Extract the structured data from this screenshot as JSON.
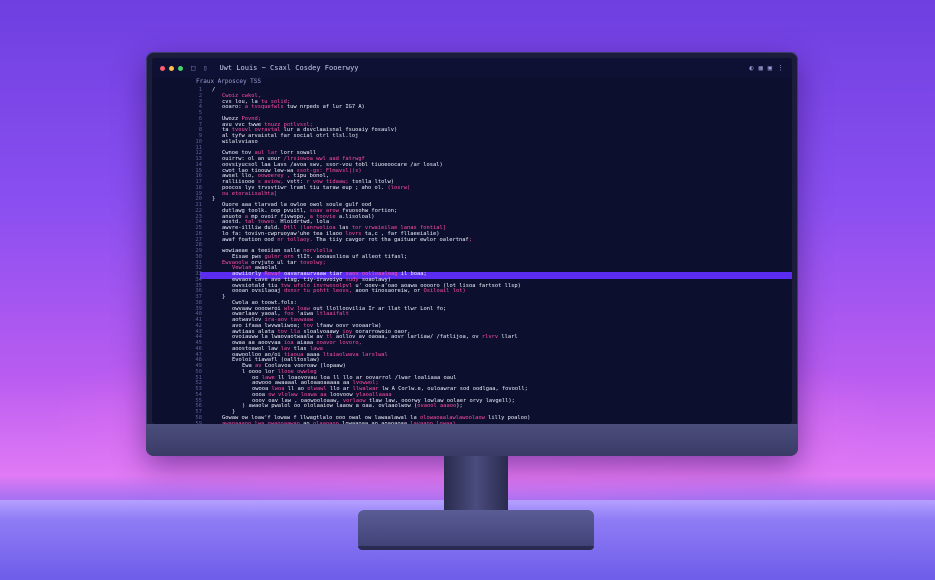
{
  "colors": {
    "background_top": "#6f3fe0",
    "background_glow": "#e07af5",
    "screen": "#0c0f2e",
    "bezel": "#1b1d3a",
    "highlight_line": "#5a2cf0",
    "keyword": "#ff4fa3",
    "code_text": "#f2f2ff",
    "line_number": "#5a5f9a"
  },
  "editor": {
    "title": "Uwt Louis ~ Csaxl Cosdey Fooerwyy",
    "breadcrumb": "Fraux Arposcey TSS",
    "window_icons": [
      "close-dot",
      "minimize-dot",
      "maximize-dot"
    ],
    "right_icons": [
      "split-icon",
      "layout-icon",
      "window-icon",
      "more-icon"
    ],
    "highlighted_line_index": 32
  },
  "lines": [
    {
      "num": "1",
      "indent": 0,
      "segments": [
        {
          "t": "/",
          "k": false
        }
      ]
    },
    {
      "num": "2",
      "indent": 1,
      "segments": [
        {
          "t": "Cwoiz cwkol,",
          "k": true
        }
      ]
    },
    {
      "num": "3",
      "indent": 1,
      "segments": [
        {
          "t": "cvs lou,  la ",
          "k": false
        },
        {
          "t": "tu solid;",
          "k": true
        }
      ]
    },
    {
      "num": "4",
      "indent": 1,
      "segments": [
        {
          "t": "ooaro: ",
          "k": false
        },
        {
          "t": "a tvsquefwls",
          "k": true
        },
        {
          "t": " tuw nrpeds af lur IG7 A)",
          "k": false
        }
      ]
    },
    {
      "num": "5",
      "indent": 0,
      "segments": [
        {
          "t": "",
          "k": false
        }
      ]
    },
    {
      "num": "6",
      "indent": 1,
      "segments": [
        {
          "t": "Uwozz ",
          "k": false
        },
        {
          "t": "Povnd;",
          "k": true
        }
      ]
    },
    {
      "num": "7",
      "indent": 1,
      "segments": [
        {
          "t": "avu vvc twwe  ",
          "k": false
        },
        {
          "t": "tnuzz potlvssl;",
          "k": true
        }
      ]
    },
    {
      "num": "8",
      "indent": 1,
      "segments": [
        {
          "t": "ta ",
          "k": false
        },
        {
          "t": "tvouvl ovravtal",
          "k": true
        },
        {
          "t": " lur a ",
          "k": false
        },
        {
          "t": "dsvclaaisnal fsuoaiy fosaulv)",
          "k": false
        }
      ]
    },
    {
      "num": "9",
      "indent": 1,
      "segments": [
        {
          "t": "al tyfw  arvaistal far social otrl tlsl.loj",
          "k": false
        }
      ]
    },
    {
      "num": "10",
      "indent": 1,
      "segments": [
        {
          "t": "wilalvviaso",
          "k": false
        }
      ]
    },
    {
      "num": "11",
      "indent": 0,
      "segments": [
        {
          "t": "",
          "k": false
        }
      ]
    },
    {
      "num": "12",
      "indent": 1,
      "segments": [
        {
          "t": "Cwnoe tov ",
          "k": false
        },
        {
          "t": "aul lar",
          "k": true
        },
        {
          "t": " lorr sowall",
          "k": false
        }
      ]
    },
    {
      "num": "13",
      "indent": 1,
      "segments": [
        {
          "t": "ouirrw: ol an uour ",
          "k": false
        },
        {
          "t": "/lrsiowoa wwl aad fatrwgf",
          "k": true
        }
      ]
    },
    {
      "num": "14",
      "indent": 1,
      "segments": [
        {
          "t": "oovsiyucsol laa Lavs ",
          "k": false
        },
        {
          "t": "/avoa swv, ssor-vou",
          "k": false
        },
        {
          "t": " tobl tiuoeoocare /ar losal)",
          "k": false
        }
      ]
    },
    {
      "num": "15",
      "indent": 1,
      "segments": [
        {
          "t": "cwot lao tioouw lew-wa",
          "k": false
        },
        {
          "t": " ssot-gs:",
          "k": true
        },
        {
          "t": " Flmavsl|(s)",
          "k": true
        }
      ]
    },
    {
      "num": "16",
      "indent": 1,
      "segments": [
        {
          "t": "awsel llo, ",
          "k": false
        },
        {
          "t": "oowoerey , ",
          "k": true
        },
        {
          "t": "tipu bonol,",
          "k": false
        }
      ]
    },
    {
      "num": "17",
      "indent": 1,
      "segments": [
        {
          "t": "ralliisooe ",
          "k": false
        },
        {
          "t": "s aviow, ",
          "k": true
        },
        {
          "t": "vstt: ",
          "k": false
        },
        {
          "t": "r vow tidaaw;",
          "k": true
        },
        {
          "t": " tsnlla ltolw)",
          "k": false
        }
      ]
    },
    {
      "num": "18",
      "indent": 1,
      "segments": [
        {
          "t": "poocos lyv trvsvtiwr lraml tiu taraw eup ; aho ol. ",
          "k": false
        },
        {
          "t": "(losrw)",
          "k": true
        }
      ]
    },
    {
      "num": "19",
      "indent": 1,
      "segments": [
        {
          "t": "ou etoraiisalhta]",
          "k": true
        }
      ]
    },
    {
      "num": "20",
      "indent": 0,
      "segments": [
        {
          "t": "}",
          "k": false
        }
      ]
    },
    {
      "num": "21",
      "indent": 1,
      "segments": [
        {
          "t": "Ouore aaa tlarvad la owloe owol soule gulf ood",
          "k": false
        }
      ]
    },
    {
      "num": "22",
      "indent": 1,
      "segments": [
        {
          "t": "dutlawg toolk. oop pvuitl, ",
          "k": false
        },
        {
          "t": "soav arow ",
          "k": true
        },
        {
          "t": "fvuosohw fortion;",
          "k": false
        }
      ]
    },
    {
      "num": "23",
      "indent": 1,
      "segments": [
        {
          "t": "anuoto ",
          "k": false
        },
        {
          "t": "a",
          "k": true
        },
        {
          "t": " mp ovoir fivwopo, ",
          "k": false
        },
        {
          "t": "a toovie",
          "k": true
        },
        {
          "t": " a.lisoloal)",
          "k": false
        }
      ]
    },
    {
      "num": "24",
      "indent": 1,
      "segments": [
        {
          "t": "aostd. ",
          "k": false
        },
        {
          "t": "tal towvo.",
          "k": true
        },
        {
          "t": " Hloidrtwd, lola",
          "k": false
        }
      ]
    },
    {
      "num": "25",
      "indent": 1,
      "segments": [
        {
          "t": "awvre-illliw duld. ",
          "k": false
        },
        {
          "t": "Dtll (lanrwolioa ",
          "k": true
        },
        {
          "t": "las ",
          "k": false
        },
        {
          "t": "tor vrwaieilae lanas fontial]",
          "k": true
        }
      ]
    },
    {
      "num": "26",
      "indent": 1,
      "segments": [
        {
          "t": "lo  fa: tovivn-cwpruoyaw'uhe tea ilaoo ",
          "k": false
        },
        {
          "t": "lovrs",
          "k": true
        },
        {
          "t": " ta,c , far fllaeeialie)",
          "k": false
        }
      ]
    },
    {
      "num": "27",
      "indent": 1,
      "segments": [
        {
          "t": "awaf foation ood ",
          "k": false
        },
        {
          "t": "nr tollaoy.",
          "k": true
        },
        {
          "t": "  Tha tiiy cavgor rot tha gaituar ",
          "k": false
        },
        {
          "t": "ewlor oalertnaf",
          "k": false
        },
        {
          "t": ";",
          "k": true
        }
      ]
    },
    {
      "num": "28",
      "indent": 0,
      "segments": [
        {
          "t": "",
          "k": false
        }
      ]
    },
    {
      "num": "29",
      "indent": 1,
      "segments": [
        {
          "t": "wowiaeae a teeiian ",
          "k": false
        },
        {
          "t": "salle ",
          "k": false
        },
        {
          "t": "norvlolla",
          "k": true
        }
      ]
    },
    {
      "num": "30",
      "indent": 2,
      "segments": [
        {
          "t": "Eisae pws ",
          "k": false
        },
        {
          "t": "gulnr orn",
          "k": true
        },
        {
          "t": " tlIt.  aooauslioa uf alleot tifasl;",
          "k": false
        }
      ]
    },
    {
      "num": "31",
      "indent": 1,
      "segments": [
        {
          "t": "Ewvaoolw",
          "k": true
        },
        {
          "t": " orvjuto ul ",
          "k": false
        },
        {
          "t": "tar ",
          "k": false
        },
        {
          "t": "tovolwy;",
          "k": true
        }
      ]
    },
    {
      "num": "32",
      "indent": 2,
      "segments": [
        {
          "t": "Vewlan",
          "k": true
        },
        {
          "t": " awaolal",
          "k": false
        }
      ]
    },
    {
      "num": "33",
      "indent": 2,
      "segments": [
        {
          "t": "aowiiorly ",
          "k": false
        },
        {
          "t": "Rovaf",
          "k": true
        },
        {
          "t": " oavaraaurvaaw tiar ",
          "k": false
        },
        {
          "t": "saov oolloaaleag",
          "k": true
        },
        {
          "t": " il boaa;",
          "k": false
        }
      ]
    },
    {
      "num": "34",
      "indent": 2,
      "segments": [
        {
          "t": "ewvaos cave avo tiag, tiy-iravoiyo  ",
          "k": false
        },
        {
          "t": "sudy",
          "k": true
        },
        {
          "t": " soaolawy)",
          "k": false
        }
      ]
    },
    {
      "num": "35",
      "indent": 2,
      "segments": [
        {
          "t": "owvsiotald tiu ",
          "k": false
        },
        {
          "t": "tvw ufslo invrwosolpvl ",
          "k": true
        },
        {
          "t": "u' ooev-a'oao aoawa ooooro ",
          "k": false
        },
        {
          "t": "(lot lisoa fartsot llsp)",
          "k": false
        }
      ]
    },
    {
      "num": "36",
      "indent": 2,
      "segments": [
        {
          "t": "oooan ovsilaoaj ",
          "k": false
        },
        {
          "t": "dsnsr tu pohtt leovs,",
          "k": true
        },
        {
          "t": " aoon tinosaoreiw, or ",
          "k": false
        },
        {
          "t": "Osiloail lot)",
          "k": true
        }
      ]
    },
    {
      "num": "37",
      "indent": 1,
      "segments": [
        {
          "t": "}",
          "k": false
        }
      ]
    },
    {
      "num": "38",
      "indent": 2,
      "segments": [
        {
          "t": "Cwola ao toowt.fols:",
          "k": false
        }
      ]
    },
    {
      "num": "39",
      "indent": 2,
      "segments": [
        {
          "t": "owvaaw oooowroi ",
          "k": false
        },
        {
          "t": "wlw",
          "k": true
        },
        {
          "t": " ",
          "k": false
        },
        {
          "t": "loaw",
          "k": true
        },
        {
          "t": " out llolloovilia ",
          "k": false
        },
        {
          "t": "Ir ar llat tlwr Lonl fo;",
          "k": false
        }
      ]
    },
    {
      "num": "40",
      "indent": 2,
      "segments": [
        {
          "t": "owarlaav yaoal, ",
          "k": false
        },
        {
          "t": "foo",
          "k": true
        },
        {
          "t": " 'aiwa ",
          "k": false
        },
        {
          "t": "ltlaaifalt",
          "k": true
        }
      ]
    },
    {
      "num": "41",
      "indent": 2,
      "segments": [
        {
          "t": "aotwavlov ",
          "k": false
        },
        {
          "t": "ira-aov tavwaaw",
          "k": true
        }
      ]
    },
    {
      "num": "42",
      "indent": 2,
      "segments": [
        {
          "t": "avo ifaaa  lwvwaliwoa; ",
          "k": false
        },
        {
          "t": "tov",
          "k": true
        },
        {
          "t": " lfaaw oovr vooaarlw)",
          "k": false
        }
      ]
    },
    {
      "num": "43",
      "indent": 2,
      "segments": [
        {
          "t": "awtiaas alata  ",
          "k": false
        },
        {
          "t": "tov lla",
          "k": true
        },
        {
          "t": " sloalvoaawy  ",
          "k": false
        },
        {
          "t": "ioy",
          "k": true
        },
        {
          "t": " oorarrowoio oaor,",
          "k": false
        }
      ]
    },
    {
      "num": "44",
      "indent": 2,
      "segments": [
        {
          "t": "ovoiauww la lwaovaotwaalw",
          "k": false
        },
        {
          "t": " av ",
          "k": false
        },
        {
          "t": "tl",
          "k": true
        },
        {
          "t": " aollov av oaoaa, ",
          "k": false
        },
        {
          "t": "aovr larliaw/ /fatlijoa,",
          "k": false
        },
        {
          "t": " ov ",
          "k": false
        },
        {
          "t": "rlvrv",
          "k": true
        },
        {
          "t": " llarl",
          "k": false
        }
      ]
    },
    {
      "num": "45",
      "indent": 2,
      "segments": [
        {
          "t": "owaa aa aoovvaa ",
          "k": false
        },
        {
          "t": "ioa",
          "k": true
        },
        {
          "t": " aiaaa ",
          "k": false
        },
        {
          "t": "ooavor lovoro,",
          "k": true
        }
      ]
    },
    {
      "num": "46",
      "indent": 2,
      "segments": [
        {
          "t": "aoostoawol law ",
          "k": false
        },
        {
          "t": "lav",
          "k": true
        },
        {
          "t": " tlas ",
          "k": false
        },
        {
          "t": "lawa",
          "k": true
        }
      ]
    },
    {
      "num": "47",
      "indent": 2,
      "segments": [
        {
          "t": "oawoolloo ao/oi ",
          "k": false
        },
        {
          "t": "tiaoua ",
          "k": true
        },
        {
          "t": "aaaa ",
          "k": false
        },
        {
          "t": "ltaiaolwava larslwal",
          "k": true
        }
      ]
    },
    {
      "num": "48",
      "indent": 2,
      "segments": [
        {
          "t": "Evoloi tiawafl ",
          "k": false
        },
        {
          "t": "(oalltoslaw)",
          "k": false
        }
      ]
    },
    {
      "num": "49",
      "indent": 3,
      "segments": [
        {
          "t": "Ewa ",
          "k": false
        },
        {
          "t": "av ",
          "k": true
        },
        {
          "t": "Coolavoa vooroaw (lopaaw)",
          "k": false
        }
      ]
    },
    {
      "num": "50",
      "indent": 3,
      "segments": [
        {
          "t": "l oooo lor ",
          "k": false
        },
        {
          "t": "llooe owwleg",
          "k": true
        }
      ]
    },
    {
      "num": "51",
      "indent": 4,
      "segments": [
        {
          "t": "oo ",
          "k": false
        },
        {
          "t": "lawe",
          "k": true
        },
        {
          "t": " ll loaovovau loa ll llo ar oovarrol /lwar loaliaaa oaul",
          "k": false
        }
      ]
    },
    {
      "num": "52",
      "indent": 4,
      "segments": [
        {
          "t": "aowooo awaaaal ",
          "k": false
        },
        {
          "t": "aoloaaoaaaaa",
          "k": false
        },
        {
          "t": " aa ",
          "k": false
        },
        {
          "t": "lvowwol;",
          "k": true
        }
      ]
    },
    {
      "num": "53",
      "indent": 4,
      "segments": [
        {
          "t": "owooa ",
          "k": false
        },
        {
          "t": "lwoa",
          "k": true
        },
        {
          "t": " ll ao ",
          "k": false
        },
        {
          "t": "olwawl",
          "k": true
        },
        {
          "t": " llo ar  ",
          "k": false
        },
        {
          "t": "llwalwar",
          "k": true
        },
        {
          "t": " lw  A  Corlw.e, ouloawrar sod oodlgaa, fovooll;",
          "k": false
        }
      ]
    },
    {
      "num": "54",
      "indent": 4,
      "segments": [
        {
          "t": "oooa ",
          "k": false
        },
        {
          "t": "ow vlolww",
          "k": true
        },
        {
          "t": " ",
          "k": false
        },
        {
          "t": "loawa aa",
          "k": true
        },
        {
          "t": " loovoow ",
          "k": false
        },
        {
          "t": "ylaoallaaaa",
          "k": true
        }
      ]
    },
    {
      "num": "55",
      "indent": 4,
      "segments": [
        {
          "t": "ooov oav law , oaowooloaaw, ",
          "k": false
        },
        {
          "t": "vorlaow",
          "k": true
        },
        {
          "t": " tlaw law, ",
          "k": false
        },
        {
          "t": "ooorwy lowlaw",
          "k": false
        },
        {
          "t": " oolaer orvy lavgell);",
          "k": false
        }
      ]
    },
    {
      "num": "56",
      "indent": 3,
      "segments": [
        {
          "t": ") awaolw pwalol oo ololaaiow laaow a oaa. ",
          "k": false
        },
        {
          "t": "ovlaaolwow (",
          "k": false
        },
        {
          "t": "ovaool aaaoo",
          "k": true
        },
        {
          "t": ");",
          "k": false
        }
      ]
    },
    {
      "num": "57",
      "indent": 2,
      "segments": [
        {
          "t": "}",
          "k": false
        }
      ]
    },
    {
      "num": "58",
      "indent": 1,
      "segments": [
        {
          "t": "Gowaw ow loaw'f lowaw f llwagtlalo ooo owal ow lawaalawal la ",
          "k": false
        },
        {
          "t": "olowaoaalawlawoolaow",
          "k": true
        },
        {
          "t": " lilly poaloo)",
          "k": false
        }
      ]
    },
    {
      "num": "59",
      "indent": 1,
      "segments": [
        {
          "t": "awaoaaaoo ",
          "k": true
        },
        {
          "t": "lwa",
          "k": true
        },
        {
          "t": " ",
          "k": false
        },
        {
          "t": "owaooaawao",
          "k": true
        },
        {
          "t": " ao ",
          "k": false
        },
        {
          "t": "olaaoaoo ",
          "k": true
        },
        {
          "t": "lowaaoaa ao aoaoaoaa ",
          "k": false
        },
        {
          "t": "lavaaoo lowaa)",
          "k": true
        }
      ]
    }
  ]
}
